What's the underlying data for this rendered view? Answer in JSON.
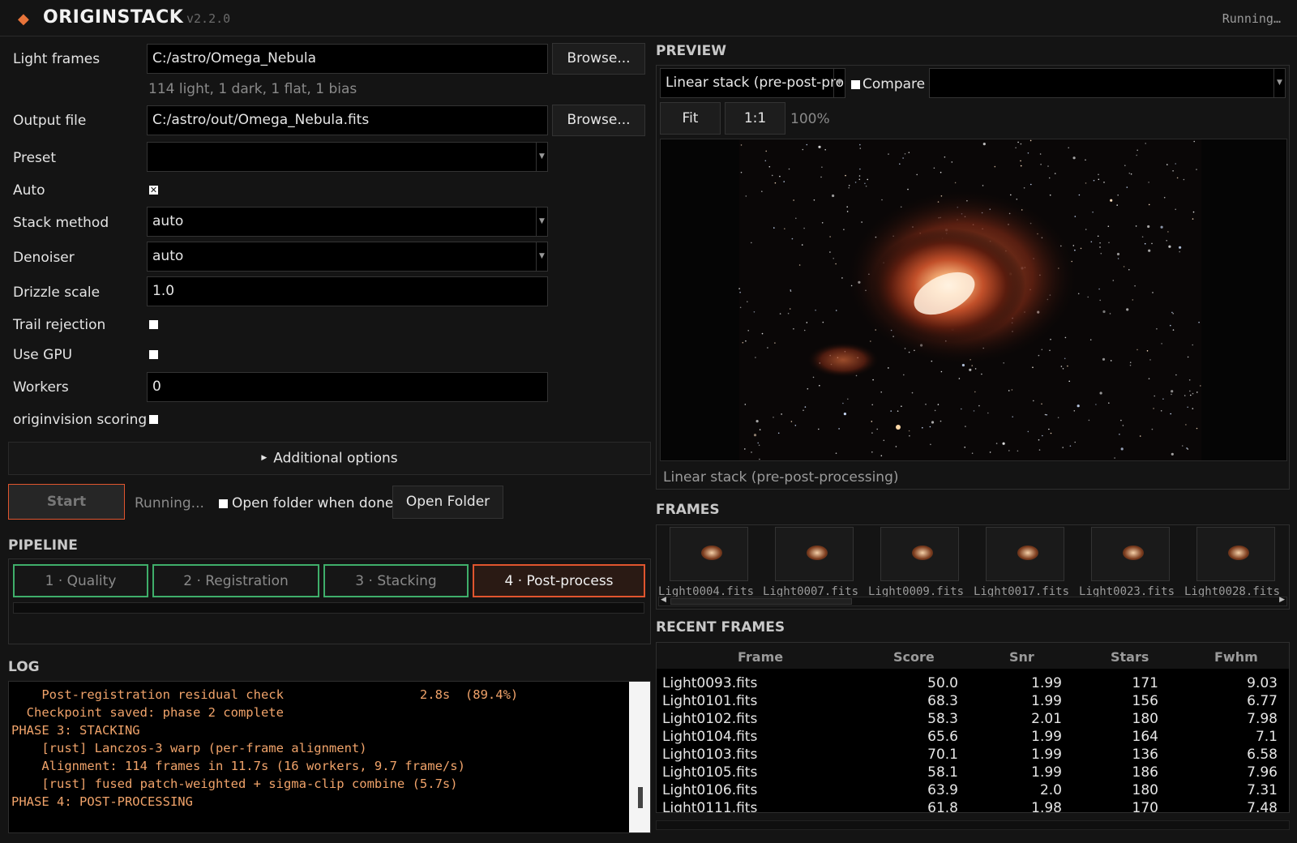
{
  "app": {
    "name": "ORIGINSTACK",
    "version": "v2.2.0",
    "status": "Running…"
  },
  "form": {
    "light_frames_label": "Light frames",
    "light_frames_value": "C:/astro/Omega_Nebula",
    "browse_label": "Browse...",
    "frames_hint": "114 light, 1 dark, 1 flat, 1 bias",
    "output_file_label": "Output file",
    "output_file_value": "C:/astro/out/Omega_Nebula.fits",
    "preset_label": "Preset",
    "preset_value": "",
    "auto_label": "Auto",
    "auto_checked": true,
    "stack_method_label": "Stack method",
    "stack_method_value": "auto",
    "denoiser_label": "Denoiser",
    "denoiser_value": "auto",
    "drizzle_label": "Drizzle scale",
    "drizzle_value": "1.0",
    "trail_label": "Trail rejection",
    "gpu_label": "Use GPU",
    "workers_label": "Workers",
    "workers_value": "0",
    "originvision_label": "originvision scoring"
  },
  "additional_options_label": "Additional options",
  "actions": {
    "start_label": "Start",
    "running_label": "Running...",
    "open_when_done_label": "Open folder when done",
    "open_folder_label": "Open Folder"
  },
  "pipeline": {
    "title": "PIPELINE",
    "stages": [
      {
        "label": "1 · Quality",
        "state": "done"
      },
      {
        "label": "2 · Registration",
        "state": "done"
      },
      {
        "label": "3 · Stacking",
        "state": "done"
      },
      {
        "label": "4 · Post-process",
        "state": "active"
      }
    ]
  },
  "log": {
    "title": "LOG",
    "lines": [
      "    Post-registration residual check                  2.8s  (89.4%)",
      "  Checkpoint saved: phase 2 complete",
      "PHASE 3: STACKING",
      "    [rust] Lanczos-3 warp (per-frame alignment)",
      "    Alignment: 114 frames in 11.7s (16 workers, 9.7 frame/s)",
      "    [rust] fused patch-weighted + sigma-clip combine (5.7s)",
      "PHASE 4: POST-PROCESSING"
    ]
  },
  "preview": {
    "title": "PREVIEW",
    "view_value": "Linear stack (pre-post-processing)",
    "compare_label": "Compare",
    "fit_label": "Fit",
    "one_to_one_label": "1:1",
    "zoom": "100%",
    "caption": "Linear stack (pre-post-processing)"
  },
  "frames": {
    "title": "FRAMES",
    "items": [
      "Light0004.fits",
      "Light0007.fits",
      "Light0009.fits",
      "Light0017.fits",
      "Light0023.fits",
      "Light0028.fits"
    ]
  },
  "recent": {
    "title": "RECENT FRAMES",
    "columns": [
      "Frame",
      "Score",
      "Snr",
      "Stars",
      "Fwhm"
    ],
    "rows": [
      [
        "Light0093.fits",
        "50.0",
        "1.99",
        "171",
        "9.03"
      ],
      [
        "Light0101.fits",
        "68.3",
        "1.99",
        "156",
        "6.77"
      ],
      [
        "Light0102.fits",
        "58.3",
        "2.01",
        "180",
        "7.98"
      ],
      [
        "Light0104.fits",
        "65.6",
        "1.99",
        "164",
        "7.1"
      ],
      [
        "Light0103.fits",
        "70.1",
        "1.99",
        "136",
        "6.58"
      ],
      [
        "Light0105.fits",
        "58.1",
        "1.99",
        "186",
        "7.96"
      ],
      [
        "Light0106.fits",
        "63.9",
        "2.0",
        "180",
        "7.31"
      ],
      [
        "Light0111.fits",
        "61.8",
        "1.98",
        "170",
        "7.48"
      ]
    ]
  },
  "colors": {
    "accent": "#e0552e",
    "done": "#3fae6a",
    "log_text": "#f0a36a"
  }
}
